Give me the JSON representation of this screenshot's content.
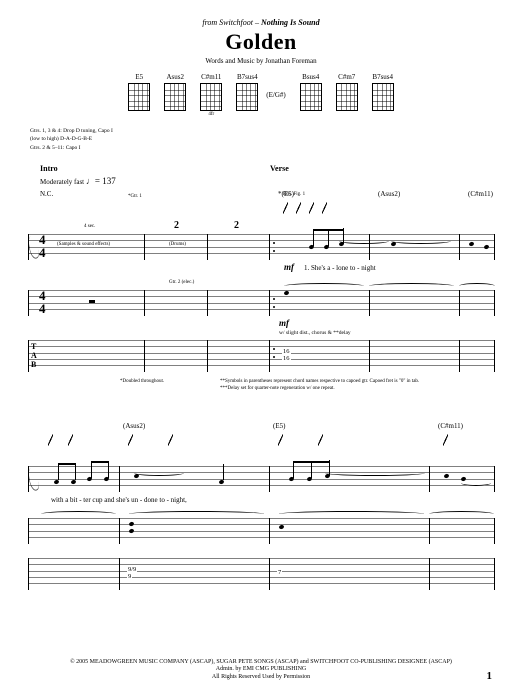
{
  "header": {
    "source_prefix": "from Switchfoot – ",
    "album": "Nothing Is Sound",
    "title": "Golden",
    "credit": "Words and Music by Jonathan Foreman"
  },
  "chords": [
    {
      "name": "E5",
      "fret": ""
    },
    {
      "name": "Asus2",
      "fret": ""
    },
    {
      "name": "C#m11",
      "fret": "4fr"
    },
    {
      "name": "B7sus4",
      "fret": ""
    },
    {
      "name": "Bsus4",
      "fret": ""
    },
    {
      "name": "C#m7",
      "fret": ""
    },
    {
      "name": "B7sus4",
      "fret": ""
    }
  ],
  "chord_side_label": "(E/G#)",
  "tuning": {
    "line1": "Gtrs. 1, 3 & 4: Drop D tuning, Capo I",
    "line2": "(low to high) D-A-D-G-B-E",
    "line3": "Gtrs. 2 & 5–11: Capo I"
  },
  "sections": {
    "intro": "Intro",
    "verse": "Verse"
  },
  "tempo": {
    "label": "Moderately fast",
    "marking": "♩= 137"
  },
  "system1": {
    "nc": "N.C.",
    "chords": {
      "e5": "*(E5)",
      "asus2": "(Asus2)",
      "cm11": "(C#m11)"
    },
    "cue_gtr1": "*Gtr. 1",
    "cue_samples": "(Samples & sound effects)",
    "cue_drums": "(Drums)",
    "cue_4sec": "4 sec.",
    "cue_riff": "Rhy. Fig. 1",
    "cue_gtr2": "Gtr. 2 (elec.)",
    "dyn1": "mf",
    "dyn2": "mf",
    "delay_note": "w/ slight dist., chorus & **delay",
    "lyric": "1. She's   a - lone                           to - night",
    "tab_nums": {
      "a": "16",
      "b": "16"
    }
  },
  "footnotes": {
    "a": "*Doubled throughout.",
    "b": "**Symbols in parentheses represent chord names respective to capoed gtr. Capoed fret is \"0\" in tab.",
    "c": "***Delay set for quarter-note regeneration w/ one repeat."
  },
  "system2": {
    "chords": {
      "asus2": "(Asus2)",
      "e5": "(E5)",
      "cm11": "(C#m11)"
    },
    "lyric": "with    a   bit - ter    cup         and        she's   un - done        to - night,",
    "tab_nums": {
      "a": "9/9",
      "b": "9",
      "c": "7"
    }
  },
  "copyright": {
    "line1": "© 2005 MEADOWGREEN MUSIC COMPANY (ASCAP), SUGAR PETE SONGS (ASCAP) and SWITCHFOOT CO-PUBLISHING DESIGNEE (ASCAP)",
    "line2": "Admin. by EMI CMG PUBLISHING",
    "line3": "All Rights Reserved   Used by Permission"
  },
  "page": "1"
}
